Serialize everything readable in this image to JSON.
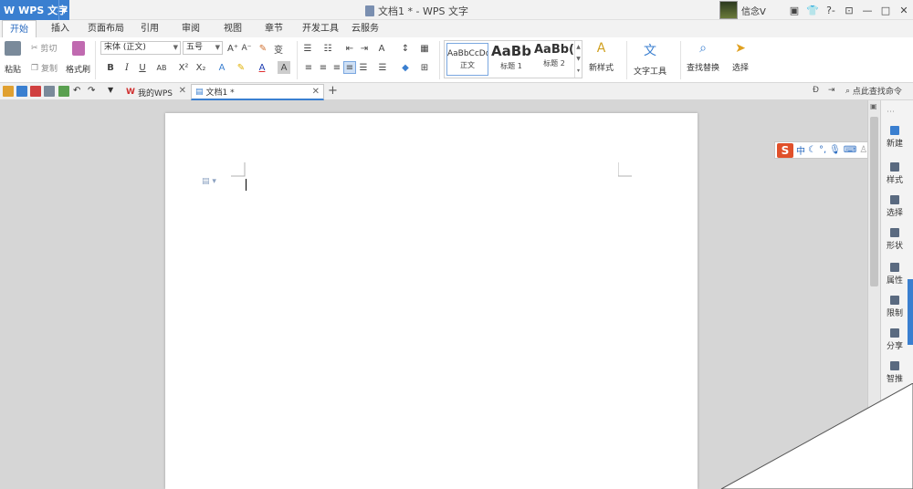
{
  "titlebar": {
    "app_name": "WPS 文字",
    "window_title": "文档1 * - WPS 文字",
    "username": "信念V",
    "controls": [
      "▣",
      "👕",
      "?-",
      "⊡",
      "—",
      "□",
      "✕"
    ]
  },
  "menu": {
    "tabs": [
      "开始",
      "插入",
      "页面布局",
      "引用",
      "审阅",
      "视图",
      "章节",
      "开发工具",
      "云服务"
    ]
  },
  "ribbon": {
    "paste": "粘贴",
    "cut": "剪切",
    "copy": "复制",
    "format_painter": "格式刷",
    "font_name": "宋体 (正文)",
    "font_size": "五号",
    "styles": [
      {
        "preview": "AaBbCcDd",
        "name": "正文"
      },
      {
        "preview": "AaBb",
        "name": "标题 1"
      },
      {
        "preview": "AaBb(",
        "name": "标题 2"
      }
    ],
    "new_style": "新样式",
    "text_tools": "文字工具",
    "find_replace": "查找替换",
    "select": "选择"
  },
  "qat": {
    "tabs": [
      {
        "label": "我的WPS"
      },
      {
        "label": "文档1 *"
      }
    ],
    "add_tab": "+",
    "search_command": "点此查找命令"
  },
  "ime": {
    "logo": "S",
    "mode": "中"
  },
  "taskpane": {
    "items": [
      "新建",
      "样式",
      "选择",
      "形状",
      "属性",
      "限制",
      "分享",
      "智推"
    ]
  },
  "colors": {
    "accent": "#3a7fd0",
    "title_bg": "#f2f2f2",
    "workspace_bg": "#d6d6d6"
  }
}
